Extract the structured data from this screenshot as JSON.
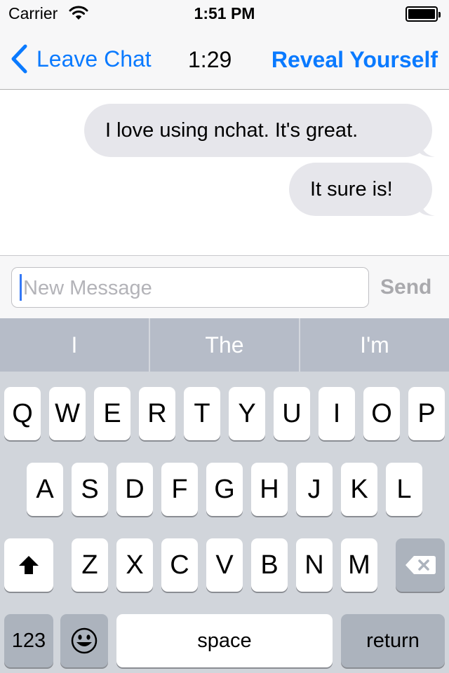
{
  "status_bar": {
    "carrier": "Carrier",
    "time": "1:51 PM",
    "battery_percent": 100
  },
  "nav": {
    "back_label": "Leave Chat",
    "timer": "1:29",
    "reveal_label": "Reveal Yourself"
  },
  "messages": [
    {
      "text": "I love using nchat. It's great."
    },
    {
      "text": "It sure is!"
    }
  ],
  "composer": {
    "placeholder": "New Message",
    "value": "",
    "send_label": "Send"
  },
  "predictions": [
    "I",
    "The",
    "I'm"
  ],
  "keyboard": {
    "row1": [
      "Q",
      "W",
      "E",
      "R",
      "T",
      "Y",
      "U",
      "I",
      "O",
      "P"
    ],
    "row2": [
      "A",
      "S",
      "D",
      "F",
      "G",
      "H",
      "J",
      "K",
      "L"
    ],
    "row3": [
      "Z",
      "X",
      "C",
      "V",
      "B",
      "N",
      "M"
    ],
    "numbers_label": "123",
    "space_label": "space",
    "return_label": "return"
  },
  "colors": {
    "accent": "#0a7aff",
    "bubble": "#e6e6eb",
    "keyboard_bg": "#d1d5db",
    "predict_bg": "#b6bcc8"
  }
}
